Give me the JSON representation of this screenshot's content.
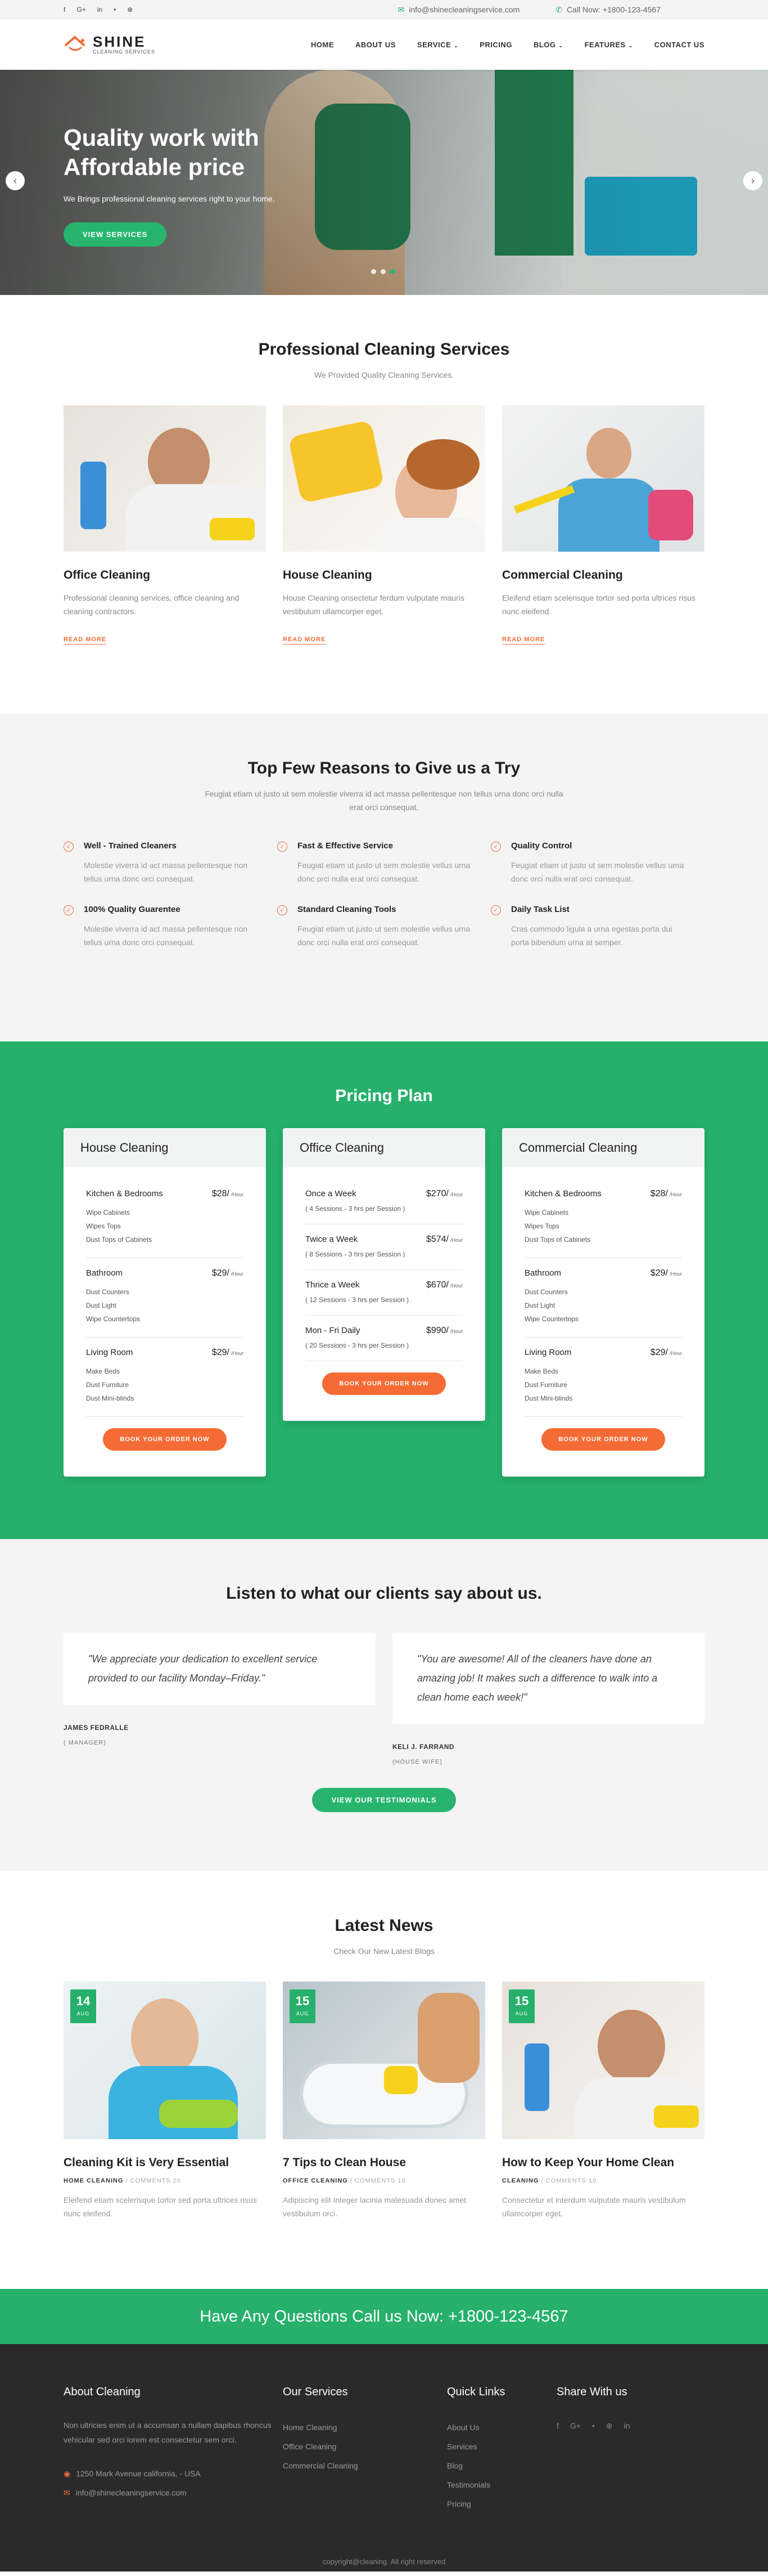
{
  "topbar": {
    "socials": [
      "f",
      "G+",
      "in",
      "•",
      "⊕"
    ],
    "email_icon": "✉",
    "email": "info@shinecleaningservice.com",
    "phone_icon": "✆",
    "phone": "Call Now: +1800-123-4567"
  },
  "header": {
    "logo_name": "SHINE",
    "logo_sub": "CLEANING SERVICES",
    "nav": [
      {
        "label": "HOME",
        "caret": ""
      },
      {
        "label": "ABOUT US",
        "caret": ""
      },
      {
        "label": "SERVICE",
        "caret": "⌄"
      },
      {
        "label": "PRICING",
        "caret": ""
      },
      {
        "label": "BLOG",
        "caret": "⌄"
      },
      {
        "label": "FEATURES",
        "caret": "⌄"
      },
      {
        "label": "CONTACT US",
        "caret": ""
      }
    ]
  },
  "hero": {
    "title": "Quality work with Affordable price",
    "subtitle": "We Brings professional cleaning services right to your home.",
    "button": "VIEW SERVICES",
    "prev": "‹",
    "next": "›",
    "slide_count": 3,
    "active_slide": 3
  },
  "services": {
    "title": "Professional Cleaning Services",
    "subtitle": "We Provided Quality Cleaning Services.",
    "items": [
      {
        "title": "Office Cleaning",
        "text": "Professional cleaning services, office cleaning and cleaning contractors.",
        "link": "READ MORE"
      },
      {
        "title": "House Cleaning",
        "text": "House Cleaning onsectetur ferdum vulputate mauris vestibulum ullamcorper eget.",
        "link": "READ MORE"
      },
      {
        "title": "Commercial Cleaning",
        "text": "Eleifend etiam scelerisque tortor sed porta ultrices risus nunc eleifend.",
        "link": "READ MORE"
      }
    ]
  },
  "reasons": {
    "title": "Top Few Reasons to Give us a Try",
    "subtitle": "Feugiat etiam ut justo ut sem molestie viverra id act massa pellentesque non tellus urna donc orci nulla erat orci consequat.",
    "items": [
      {
        "title": "Well - Trained Cleaners",
        "text": "Molestie viverra id act massa pellentesque non tellus urna donc orci consequat."
      },
      {
        "title": "Fast & Effective Service",
        "text": "Feugiat etiam ut justo ut sem molestie vellus urna donc orci nulla erat orci consequat."
      },
      {
        "title": "Quality Control",
        "text": "Feugiat etiam ut justo ut sem molestie vellus urna donc orci nulla erat orci consequat."
      },
      {
        "title": "100% Quality Guarentee",
        "text": "Molestie viverra id act massa pellentesque non tellus urna donc orci consequat."
      },
      {
        "title": "Standard Cleaning Tools",
        "text": "Feugiat etiam ut justo ut sem molestie vellus urna donc orci nulla erat orci consequat."
      },
      {
        "title": "Daily Task List",
        "text": "Cras commodo ligula a urna egestas porta dui porta bibendum urna at semper."
      }
    ]
  },
  "pricing": {
    "title": "Pricing Plan",
    "unit": "/Hour",
    "cards": [
      {
        "title": "House Cleaning",
        "rows": [
          {
            "name": "Kitchen & Bedrooms",
            "price": "$28/",
            "items": [
              "Wipe Cabinets",
              "Wipes Tops",
              "Dust Tops of Cabinets"
            ]
          },
          {
            "name": "Bathroom",
            "price": "$29/",
            "items": [
              "Dust Counters",
              "Dust Light",
              "Wipe Countertops"
            ]
          },
          {
            "name": "Living Room",
            "price": "$29/",
            "items": [
              "Make Beds",
              "Dust Furniture",
              "Dust Mini-blinds"
            ]
          }
        ],
        "button": "BOOK YOUR ORDER NOW"
      },
      {
        "title": "Office Cleaning",
        "rows": [
          {
            "name": "Once a Week",
            "price": "$270/",
            "note": "( 4 Sessions - 3 hrs per Session )"
          },
          {
            "name": "Twice a Week",
            "price": "$574/",
            "note": "( 8 Sessions - 3 hrs per Session )"
          },
          {
            "name": "Thrice a Week",
            "price": "$670/",
            "note": "( 12 Sessions - 3 hrs per Session )"
          },
          {
            "name": "Mon - Fri Daily",
            "price": "$990/",
            "note": "( 20 Sessions - 3 hrs per Session )"
          }
        ],
        "button": "BOOK YOUR ORDER NOW"
      },
      {
        "title": "Commercial Cleaning",
        "rows": [
          {
            "name": "Kitchen & Bedrooms",
            "price": "$28/",
            "items": [
              "Wipe Cabinets",
              "Wipes Tops",
              "Dust Tops of Cabinets"
            ]
          },
          {
            "name": "Bathroom",
            "price": "$29/",
            "items": [
              "Dust Counters",
              "Dust Light",
              "Wipe Countertops"
            ]
          },
          {
            "name": "Living Room",
            "price": "$29/",
            "items": [
              "Make Beds",
              "Dust Furniture",
              "Dust Mini-blinds"
            ]
          }
        ],
        "button": "BOOK YOUR ORDER NOW"
      }
    ]
  },
  "testimonials": {
    "title": "Listen to what our clients say about us.",
    "items": [
      {
        "quote": "\"We appreciate your dedication to excellent service provided to our facility Monday–Friday.\"",
        "name": "JAMES FEDRALLE",
        "role": "( MANAGER)"
      },
      {
        "quote": "\"You are awesome! All of the cleaners have done an amazing job! It makes such a difference to walk into a clean home each week!\"",
        "name": "KELI J. FARRAND",
        "role": "(HOUSE WIFE)"
      }
    ],
    "button": "VIEW OUR TESTIMONIALS"
  },
  "news": {
    "title": "Latest News",
    "subtitle": "Check Our New Latest Blogs",
    "items": [
      {
        "day": "14",
        "month": "AUG",
        "title": "Cleaning Kit is Very Essential",
        "category": "HOME CLEANING",
        "comments": "COMMENTS 20",
        "text": "Eleifend etiam scelerisque tortor sed porta ultrices risus nunc eleifend."
      },
      {
        "day": "15",
        "month": "AUG",
        "title": "7 Tips to Clean House",
        "category": "OFFICE CLEANING",
        "comments": "COMMENTS 16",
        "text": "Adipiscing elit Integer lacinia malesuada donec amet vestibulum orci."
      },
      {
        "day": "15",
        "month": "AUG",
        "title": "How to Keep Your Home Clean",
        "category": "CLEANING",
        "comments": "COMMENTS 10",
        "text": "Consectetur et interdum vulputate mauris vestibulum ullamcorper eget."
      }
    ]
  },
  "cta": {
    "text": "Have Any Questions Call us Now: +1800-123-4567"
  },
  "footer": {
    "about_title": "About Cleaning",
    "about_text": "Non ultricies enim ut a accumsan a nullam dapibus rhoncus vehicular sed orci lorem est consectetur sem orci.",
    "address_icon": "◉",
    "address": "1250 Mark Avenue california, - USA",
    "email_icon": "✉",
    "email": "info@shinecleaningservice.com",
    "services_title": "Our Services",
    "services": [
      "Home Cleaning",
      "Office Cleaning",
      "Commercial Cleaning"
    ],
    "links_title": "Quick Links",
    "links": [
      "About Us",
      "Services",
      "Blog",
      "Testimonials",
      "Pricing"
    ],
    "share_title": "Share With us",
    "share": [
      "f",
      "G+",
      "•",
      "⊕",
      "in"
    ],
    "copyright": "copyright@cleaning. All right reserved"
  },
  "colors": {
    "brand_green": "#26b06c",
    "accent_orange": "#f46b36",
    "dark_footer": "#2a2a2a"
  }
}
